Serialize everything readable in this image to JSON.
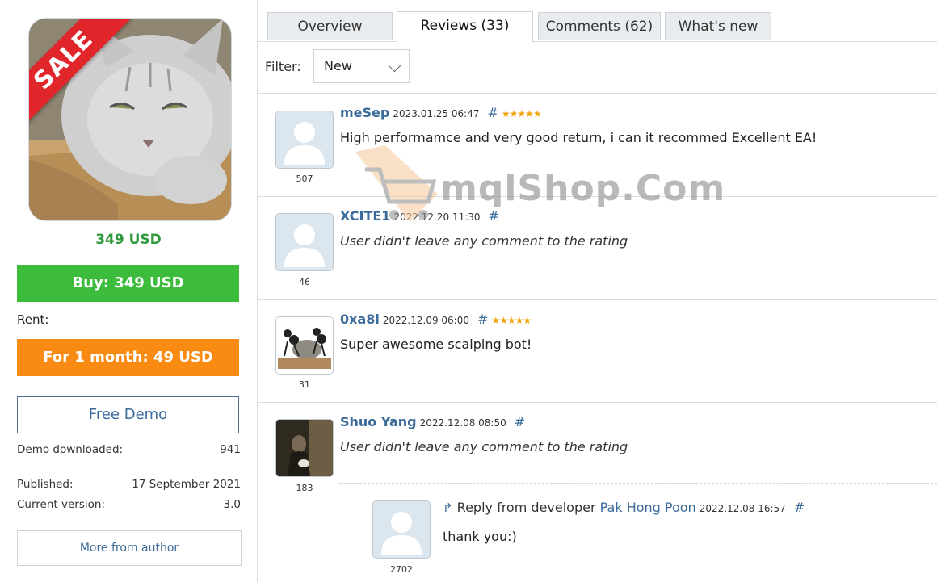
{
  "product": {
    "sale_label": "SALE",
    "price": "349 USD",
    "buy_label": "Buy: 349 USD",
    "rent_label": "Rent:",
    "rent_button": "For 1 month: 49 USD",
    "demo_button": "Free Demo",
    "demo_downloaded_label": "Demo downloaded:",
    "demo_downloaded_value": "941",
    "published_label": "Published:",
    "published_value": "17 September 2021",
    "version_label": "Current version:",
    "version_value": "3.0",
    "more_button": "More from author"
  },
  "tabs": [
    {
      "label": "Overview",
      "active": false
    },
    {
      "label": "Reviews (33)",
      "active": true
    },
    {
      "label": "Comments (62)",
      "active": false
    },
    {
      "label": "What's new",
      "active": false
    }
  ],
  "filter": {
    "label": "Filter:",
    "value": "New"
  },
  "watermark": "mqlShop.Com",
  "reviews": [
    {
      "name": "meSep",
      "date": "2023.01.25 06:47",
      "hash": "#",
      "stars": "★★★★★",
      "text": "High performamce and very good return, i can it recommed Excellent EA!",
      "count": "507",
      "avatar_icon": "default-user-icon"
    },
    {
      "name": "XCITE1",
      "date": "2022.12.20 11:30",
      "hash": "#",
      "stars": "",
      "text": "User didn't leave any comment to the rating",
      "count": "46",
      "avatar_icon": "default-user-icon"
    },
    {
      "name": "0xa8l",
      "date": "2022.12.09 06:00",
      "hash": "#",
      "stars": "★★★★★",
      "text": "Super awesome scalping bot!",
      "count": "31",
      "avatar_icon": "ants-photo-icon"
    },
    {
      "name": "Shuo Yang",
      "date": "2022.12.08 08:50",
      "hash": "#",
      "stars": "",
      "text": "User didn't leave any comment to the rating",
      "count": "183",
      "avatar_icon": "person-photo-icon"
    }
  ],
  "reply": {
    "prefix": "Reply from developer",
    "developer": "Pak Hong Poon",
    "date": "2022.12.08 16:57",
    "hash": "#",
    "text": "thank you:)",
    "count": "2702",
    "arrow_icon": "reply-arrow-icon"
  },
  "colors": {
    "buy": "#3dbb3d",
    "rent": "#f98a12",
    "link": "#3b6b9a",
    "price": "#2f9a3d",
    "sale": "#e0262a",
    "stars": "#f0a30a"
  }
}
